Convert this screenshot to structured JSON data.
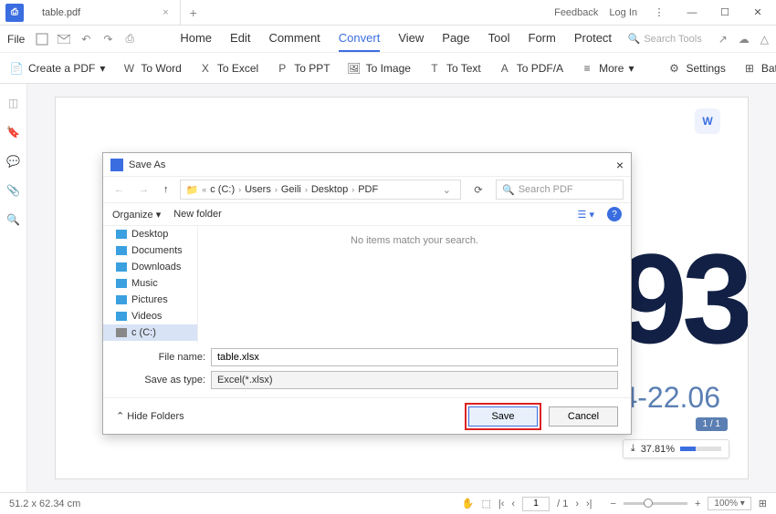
{
  "titlebar": {
    "tab_name": "table.pdf",
    "feedback": "Feedback",
    "login": "Log In"
  },
  "menubar": {
    "file": "File",
    "items": [
      "Home",
      "Edit",
      "Comment",
      "Convert",
      "View",
      "Page",
      "Tool",
      "Form",
      "Protect"
    ],
    "active_index": 3,
    "search_placeholder": "Search Tools"
  },
  "toolbar": {
    "create": "Create a PDF",
    "to_word": "To Word",
    "to_excel": "To Excel",
    "to_ppt": "To PPT",
    "to_image": "To Image",
    "to_text": "To Text",
    "to_pdfa": "To PDF/A",
    "more": "More",
    "settings": "Settings",
    "batch": "Batch Proc"
  },
  "page": {
    "big_number": "93",
    "date_range": "14-22.06",
    "progress_percent": "37.81%",
    "page_indicator": "1 / 1"
  },
  "statusbar": {
    "dimensions": "51.2 x 62.34 cm",
    "current_page": "1",
    "total_pages": "/ 1",
    "zoom": "100%"
  },
  "dialog": {
    "title": "Save As",
    "breadcrumb": [
      "c (C:)",
      "Users",
      "Geili",
      "Desktop",
      "PDF"
    ],
    "search_placeholder": "Search PDF",
    "organize": "Organize",
    "new_folder": "New folder",
    "tree": [
      {
        "label": "Desktop",
        "color": "#3aa0e0"
      },
      {
        "label": "Documents",
        "color": "#3aa0e0"
      },
      {
        "label": "Downloads",
        "color": "#3aa0e0"
      },
      {
        "label": "Music",
        "color": "#3aa0e0"
      },
      {
        "label": "Pictures",
        "color": "#3aa0e0"
      },
      {
        "label": "Videos",
        "color": "#3aa0e0"
      },
      {
        "label": "c (C:)",
        "color": "#888"
      }
    ],
    "empty_msg": "No items match your search.",
    "filename_label": "File name:",
    "filename_value": "table.xlsx",
    "saveas_label": "Save as type:",
    "saveas_value": "Excel(*.xlsx)",
    "hide_folders": "Hide Folders",
    "save": "Save",
    "cancel": "Cancel"
  }
}
